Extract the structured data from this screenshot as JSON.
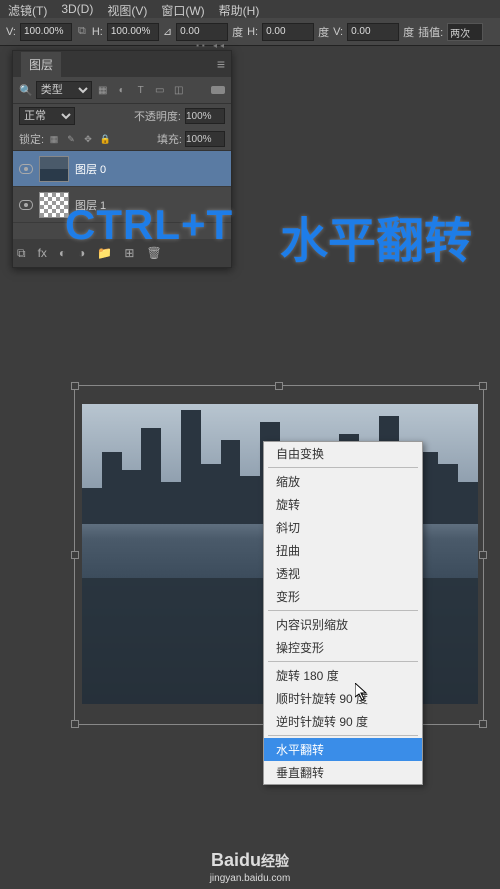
{
  "menubar": {
    "filter": "滤镜(T)",
    "threeD": "3D(D)",
    "view": "视图(V)",
    "window": "窗口(W)",
    "help": "帮助(H)"
  },
  "options": {
    "v_label": "V:",
    "v_value": "100.00%",
    "h_label": "H:",
    "h_value": "100.00%",
    "angle_icon": "⊿",
    "angle_value": "0.00",
    "deg_label": "度",
    "h2_label": "H:",
    "h2_value": "0.00",
    "deg2_label": "度",
    "v2_label": "V:",
    "v2_value": "0.00",
    "deg3_label": "度",
    "interp_label": "插值:",
    "interp_value": "两次"
  },
  "overlay1": "CTRL+T",
  "overlay2": "水平翻转",
  "panel": {
    "tab": "图层",
    "filter_type": "类型",
    "blend_mode": "正常",
    "opacity_label": "不透明度:",
    "opacity_value": "100%",
    "lock_label": "锁定:",
    "fill_label": "填充:",
    "fill_value": "100%"
  },
  "layers": [
    {
      "name": "图层 0"
    },
    {
      "name": "图层 1"
    }
  ],
  "context": {
    "title": "自由变换",
    "scale": "缩放",
    "rotate": "旋转",
    "skew": "斜切",
    "distort": "扭曲",
    "perspective": "透视",
    "warp": "变形",
    "content_aware": "内容识别缩放",
    "puppet": "操控变形",
    "rot180": "旋转 180 度",
    "rot90cw": "顺时针旋转 90 度",
    "rot90ccw": "逆时针旋转 90 度",
    "flip_h": "水平翻转",
    "flip_v": "垂直翻转"
  },
  "watermark": {
    "logo_en": "Baidu",
    "logo_cn": "经验",
    "url": "jingyan.baidu.com"
  }
}
